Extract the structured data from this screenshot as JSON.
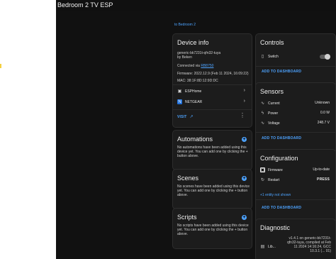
{
  "header": {
    "title": "Bedroom 2 TV ESP"
  },
  "breadcrumb": {
    "area_link": "to Bedroom 2"
  },
  "device_info": {
    "title": "Device info",
    "model": "generic-bk7231t-qfn32-tuya",
    "by": "by Beken",
    "connected_label": "Connected via",
    "connected_link": "RB8750",
    "firmware": "Firmware: 2022.12.9 (Feb 11 2024, 16:09:22)",
    "mac": "MAC: 38:1F:8D:12:9D:DC",
    "integrations": [
      {
        "label": "ESPHome",
        "icon": "esphome-icon"
      },
      {
        "label": "NETGEAR",
        "icon": "netgear-icon"
      }
    ],
    "visit_label": "VISIT"
  },
  "automations": {
    "title": "Automations",
    "empty_text": "No automations have been added using this device yet. You can add one by clicking the + button above."
  },
  "scenes": {
    "title": "Scenes",
    "empty_text": "No scenes have been added using this device yet. You can add one by clicking the + button above."
  },
  "scripts": {
    "title": "Scripts",
    "empty_text": "No scripts have been added using this device yet. You can add one by clicking the + button above."
  },
  "controls": {
    "title": "Controls",
    "switch_label": "Switch",
    "add_label": "ADD TO DASHBOARD",
    "switch_on": false
  },
  "sensors": {
    "title": "Sensors",
    "items": [
      {
        "label": "Current",
        "value": "Unknown",
        "icon": "current-icon"
      },
      {
        "label": "Power",
        "value": "0.0 W",
        "icon": "power-icon"
      },
      {
        "label": "Voltage",
        "value": "248.7 V",
        "icon": "voltage-icon"
      }
    ],
    "add_label": "ADD TO DASHBOARD"
  },
  "configuration": {
    "title": "Configuration",
    "firmware_label": "Firmware",
    "firmware_value": "Up-to-date",
    "restart_label": "Restart",
    "restart_action": "PRESS",
    "hidden_entity": "+1 entity not shown",
    "add_label": "ADD TO DASHBOARD"
  },
  "diagnostic": {
    "title": "Diagnostic",
    "lib_label": "Lib...",
    "lib_value": "v1.4.1 on generic-bk7231t-qfn32-tuya, compiled at Feb 11 2024 14:16:24, GCC 10.3.1 (... 01)"
  },
  "colors": {
    "accent": "#4da3ff",
    "background": "#111111",
    "card": "#1c1c1c"
  }
}
